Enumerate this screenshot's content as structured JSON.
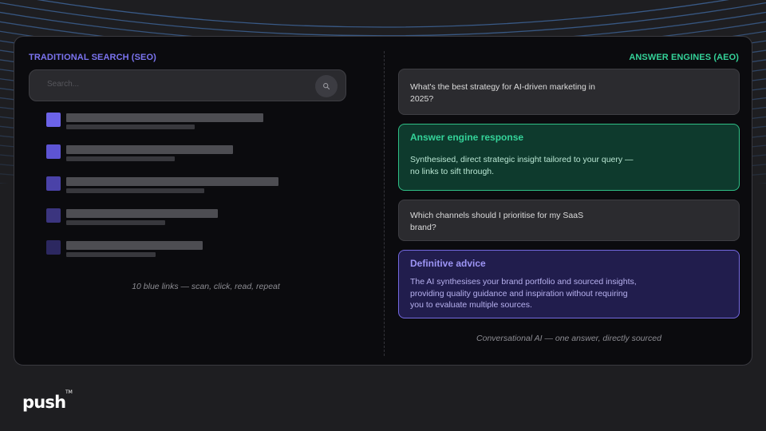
{
  "seo": {
    "heading": "TRADITIONAL SEARCH (SEO)",
    "search_placeholder": "Search...",
    "search_icon": "search-icon",
    "results": [
      {
        "square_color": "#6c63e8"
      },
      {
        "square_color": "#5d54d3"
      },
      {
        "square_color": "#4a42a8"
      },
      {
        "square_color": "#3b357f"
      },
      {
        "square_color": "#2c2860"
      }
    ],
    "caption": "10 blue links — scan, click, read, repeat"
  },
  "aeo": {
    "heading": "ANSWER ENGINES (AEO)",
    "query1": "What's the best strategy for AI-driven marketing in 2025?",
    "response1": {
      "title": "Answer engine response",
      "body": "Synthesised, direct strategic insight tailored to your query — no links to sift through."
    },
    "query2": "Which channels should I prioritise for my SaaS brand?",
    "response2": {
      "title": "Definitive advice",
      "body": "The AI synthesises your brand portfolio and sourced insights, providing quality guidance and inspiration without requiring you to evaluate multiple sources."
    },
    "caption": "Conversational AI — one answer, directly sourced"
  },
  "brand": {
    "logo": "push",
    "trademark": "TM"
  },
  "colors": {
    "seo_accent": "#7b74f0",
    "aeo_accent": "#34d399",
    "green_panel": "#0e3a2d",
    "purple_panel": "#211d4d",
    "page_background": "#1e1e21"
  }
}
